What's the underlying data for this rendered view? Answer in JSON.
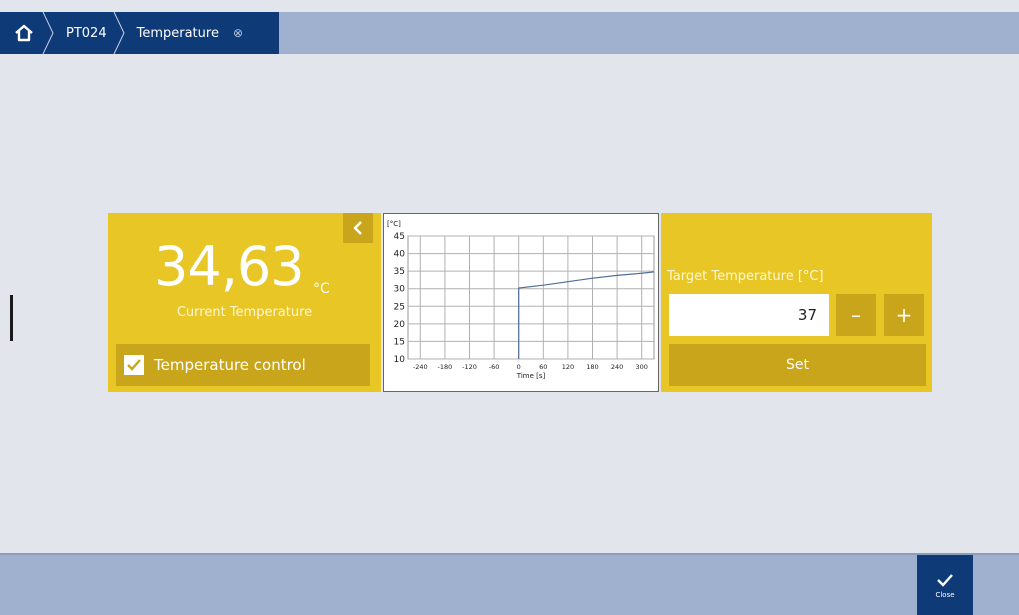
{
  "breadcrumb": {
    "home_icon": "home-icon",
    "items": [
      "PT024",
      "Temperature"
    ],
    "close_glyph": "⊗"
  },
  "current": {
    "value": "34,63",
    "unit": "°C",
    "label": "Current Temperature"
  },
  "control": {
    "label": "Temperature control",
    "checked": true
  },
  "target": {
    "label": "Target Temperature [°C]",
    "value": "37",
    "minus_label": "–",
    "plus_label": "+",
    "set_label": "Set"
  },
  "footer": {
    "close_label": "Close"
  },
  "colors": {
    "panel": "#e8c626",
    "panel_dark": "#c9a51b",
    "nav": "#0f3a78",
    "bar": "#9fb1cf",
    "series": "#4f6f9a"
  },
  "chart_data": {
    "type": "line",
    "ylabel": "[°C]",
    "xlabel": "Time [s]",
    "xlim": [
      -270,
      330
    ],
    "ylim": [
      10,
      45
    ],
    "x_ticks": [
      -240,
      -180,
      -120,
      -60,
      0,
      60,
      120,
      180,
      240,
      300
    ],
    "y_ticks": [
      10,
      15,
      20,
      25,
      30,
      35,
      40,
      45
    ],
    "grid": true,
    "series": [
      {
        "x": [
          0,
          0,
          60,
          120,
          180,
          240,
          300,
          330
        ],
        "values": [
          10,
          30.2,
          31,
          32,
          33,
          33.8,
          34.4,
          34.8
        ]
      }
    ]
  }
}
